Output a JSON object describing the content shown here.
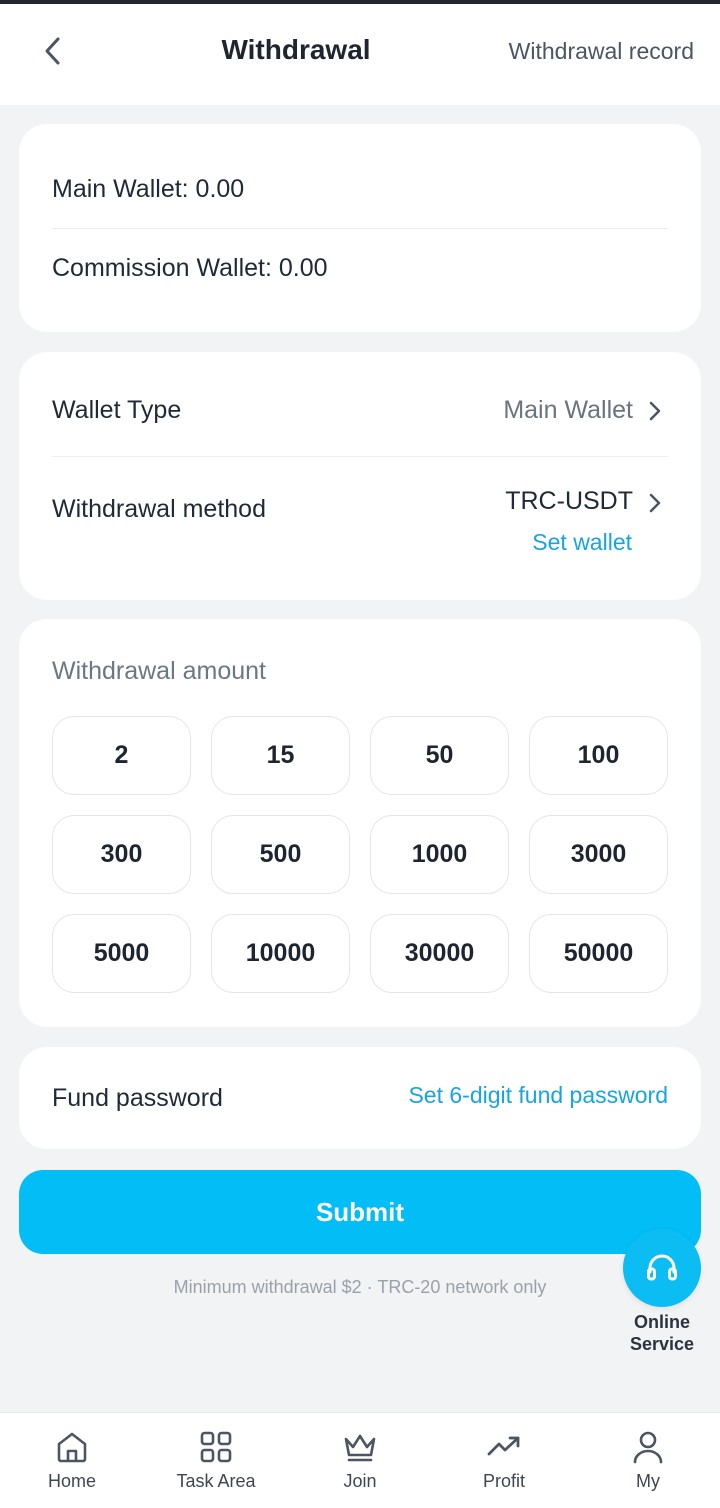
{
  "header": {
    "title": "Withdrawal",
    "record_label": "Withdrawal record"
  },
  "wallets": {
    "main": "Main Wallet: 0.00",
    "commission": "Commission Wallet: 0.00"
  },
  "settings": {
    "wallet_type_label": "Wallet Type",
    "wallet_type_value": "Main Wallet",
    "method_label": "Withdrawal method",
    "method_value": "TRC-USDT",
    "set_wallet_label": "Set wallet"
  },
  "amount": {
    "title": "Withdrawal amount",
    "options": [
      "2",
      "15",
      "50",
      "100",
      "300",
      "500",
      "1000",
      "3000",
      "5000",
      "10000",
      "30000",
      "50000"
    ]
  },
  "fund_password": {
    "label": "Fund password",
    "action": "Set 6-digit fund password"
  },
  "submit_label": "Submit",
  "note": "Minimum withdrawal $2 · TRC-20 network only",
  "service": {
    "line1": "Online",
    "line2": "Service"
  },
  "tabs": [
    {
      "label": "Home",
      "icon": "home-icon"
    },
    {
      "label": "Task Area",
      "icon": "grid-icon"
    },
    {
      "label": "Join",
      "icon": "crown-icon"
    },
    {
      "label": "Profit",
      "icon": "trending-up-icon"
    },
    {
      "label": "My",
      "icon": "user-icon"
    }
  ],
  "colors": {
    "accent": "#02bdf6",
    "link": "#17a5e0",
    "background": "#f2f3f5"
  }
}
